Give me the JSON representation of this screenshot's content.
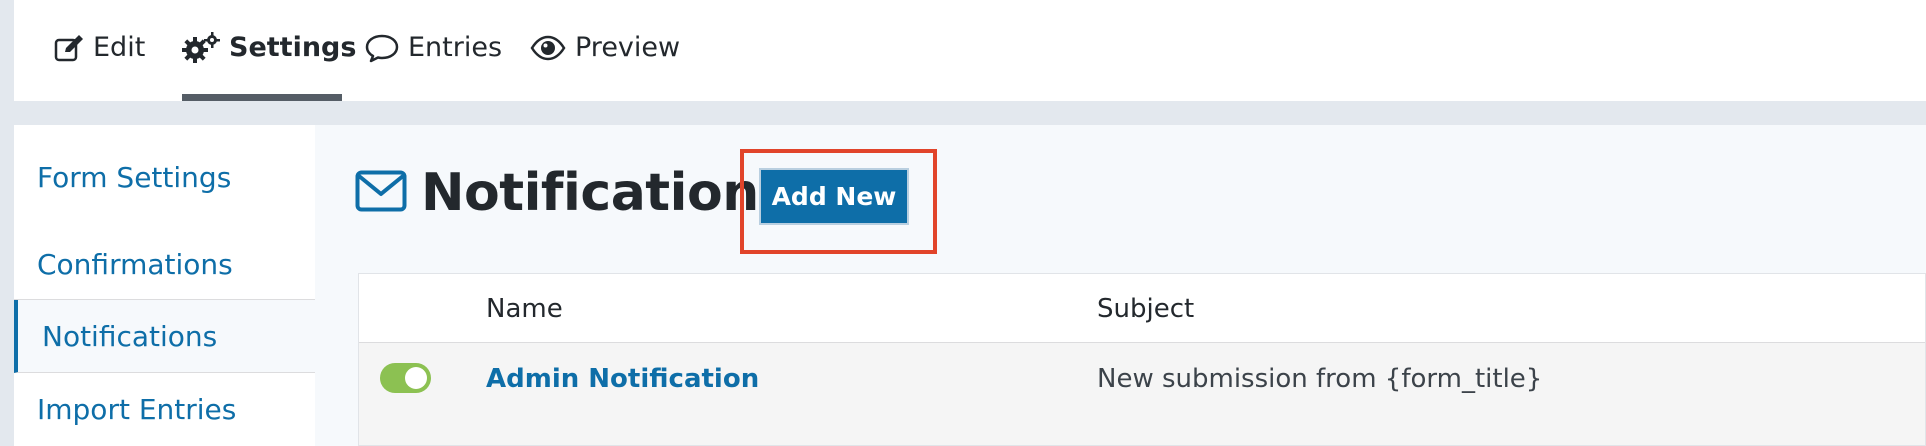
{
  "toolbar": {
    "tabs": [
      {
        "label": "Edit",
        "icon": "edit-icon"
      },
      {
        "label": "Settings",
        "icon": "gears-icon",
        "active": true
      },
      {
        "label": "Entries",
        "icon": "comment-icon"
      },
      {
        "label": "Preview",
        "icon": "eye-icon"
      }
    ]
  },
  "sidebar": {
    "items": [
      {
        "label": "Form Settings"
      },
      {
        "label": "Confirmations"
      },
      {
        "label": "Notifications",
        "active": true
      },
      {
        "label": "Import Entries"
      }
    ]
  },
  "main": {
    "title": "Notifications",
    "title_icon": "envelope-icon",
    "add_button": "Add New",
    "table": {
      "columns": [
        "Name",
        "Subject"
      ],
      "rows": [
        {
          "active": true,
          "name": "Admin Notification",
          "subject": "New submission from {form_title}"
        }
      ]
    }
  },
  "colors": {
    "accent": "#0e6ea8",
    "highlight_box": "#e1442a",
    "toggle_on": "#8cc152"
  }
}
